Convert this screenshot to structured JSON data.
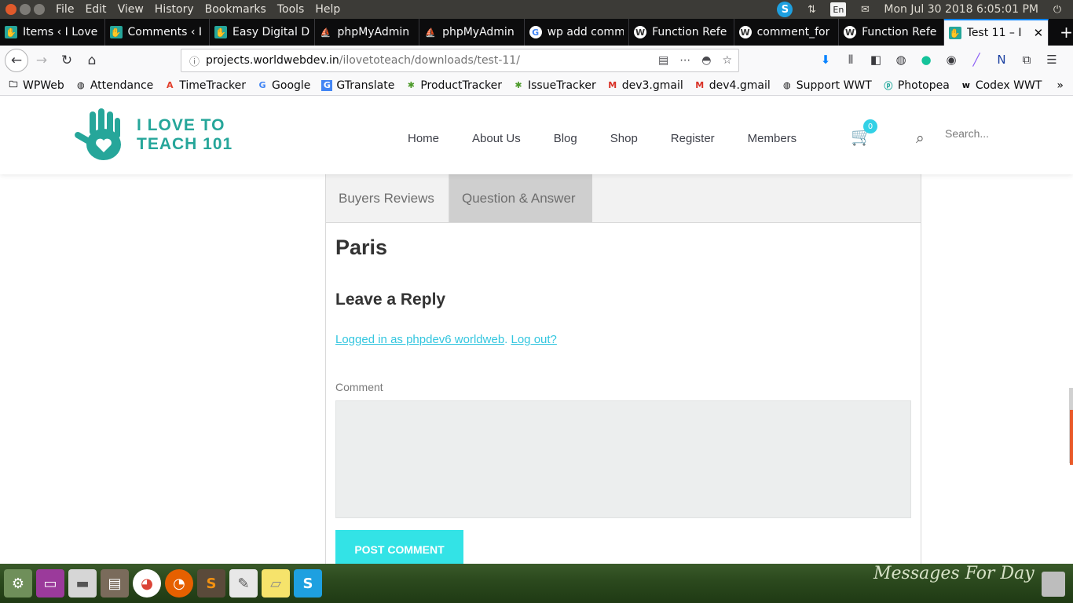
{
  "os": {
    "menu": [
      "File",
      "Edit",
      "View",
      "History",
      "Bookmarks",
      "Tools",
      "Help"
    ],
    "tray": {
      "keyboard": "En",
      "clock": "Mon Jul 30 2018  6:05:01 PM"
    }
  },
  "browser": {
    "tabs": [
      {
        "label": "Items ‹ I Love",
        "icon": "site-hand-icon"
      },
      {
        "label": "Comments ‹ I",
        "icon": "site-hand-icon"
      },
      {
        "label": "Easy Digital D",
        "icon": "site-hand-icon"
      },
      {
        "label": "phpMyAdmin",
        "icon": "phpmyadmin-icon"
      },
      {
        "label": "phpMyAdmin",
        "icon": "phpmyadmin-icon"
      },
      {
        "label": "wp add comm",
        "icon": "google-icon"
      },
      {
        "label": "Function Refe",
        "icon": "wordpress-icon"
      },
      {
        "label": "comment_for",
        "icon": "wordpress-icon"
      },
      {
        "label": "Function Refe",
        "icon": "wordpress-icon"
      },
      {
        "label": "Test 11 – I",
        "icon": "site-hand-icon",
        "active": true
      }
    ],
    "url": {
      "host": "projects.worldwebdev.in",
      "path": "/ilovetoteach/downloads/test-11/"
    },
    "bookmarks": [
      "WPWeb",
      "Attendance",
      "TimeTracker",
      "Google",
      "GTranslate",
      "ProductTracker",
      "IssueTracker",
      "dev3.gmail",
      "dev4.gmail",
      "Support WWT",
      "Photopea",
      "Codex WWT"
    ]
  },
  "site": {
    "logo": {
      "line1": "I LOVE TO",
      "line2": "TEACH 101"
    },
    "nav": [
      "Home",
      "About Us",
      "Blog",
      "Shop",
      "Register",
      "Members"
    ],
    "cart_count": "0",
    "search_placeholder": "Search..."
  },
  "content": {
    "tabs": [
      "Buyers Reviews",
      "Question & Answer"
    ],
    "answer": "Paris",
    "reply_title": "Leave a Reply",
    "logged_in_text": "Logged in as phpdev6 worldweb",
    "logout_text": "Log out?",
    "comment_label": "Comment",
    "post_button": "Post Comment"
  },
  "dock": {
    "wallpaper_text": "Messages For Day"
  },
  "colors": {
    "accent": "#33e3e6",
    "brand": "#26a69a",
    "link": "#33c6df"
  }
}
